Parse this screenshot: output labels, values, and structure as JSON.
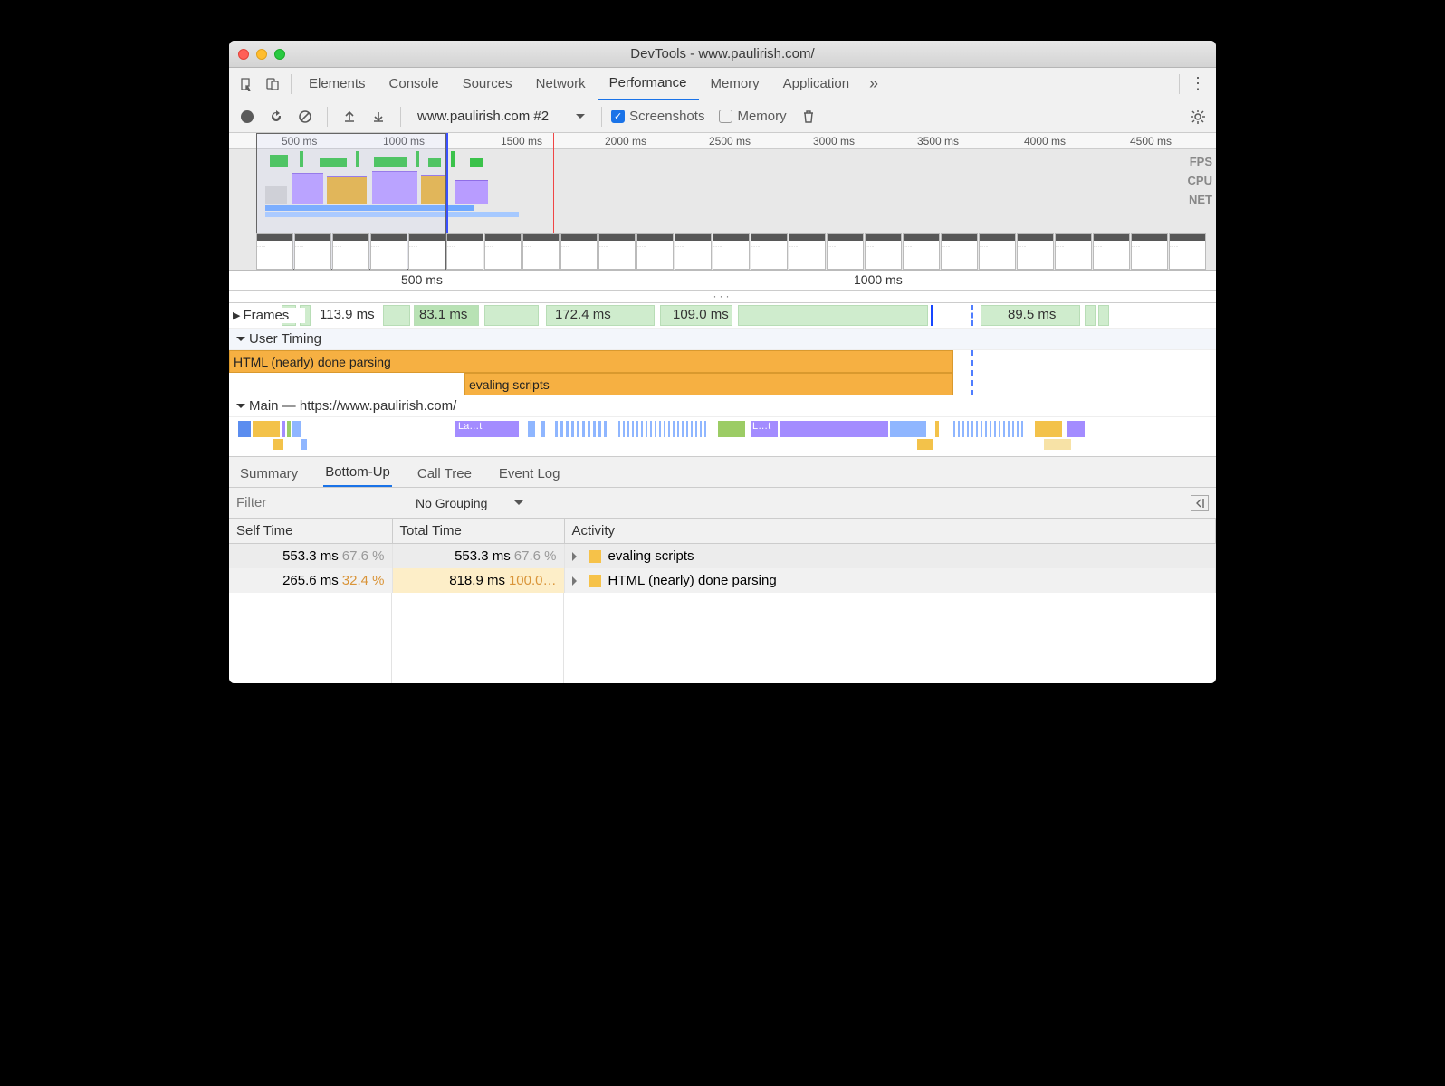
{
  "window": {
    "title": "DevTools - www.paulirish.com/"
  },
  "main_tabs": {
    "elements": "Elements",
    "console": "Console",
    "sources": "Sources",
    "network": "Network",
    "performance": "Performance",
    "memory": "Memory",
    "application": "Application"
  },
  "toolbar": {
    "record_select": "www.paulirish.com #2",
    "screenshots": "Screenshots",
    "memory": "Memory"
  },
  "overview": {
    "ticks": [
      "500 ms",
      "1000 ms",
      "1500 ms",
      "2000 ms",
      "2500 ms",
      "3000 ms",
      "3500 ms",
      "4000 ms",
      "4500 ms"
    ],
    "labels": {
      "fps": "FPS",
      "cpu": "CPU",
      "net": "NET"
    }
  },
  "detail_ruler": {
    "t500": "500 ms",
    "t1000": "1000 ms"
  },
  "frames": {
    "label": "Frames",
    "values": [
      "113.9 ms",
      "83.1 ms",
      "172.4 ms",
      "109.0 ms",
      "89.5 ms"
    ]
  },
  "user_timing": {
    "label": "User Timing",
    "bar1": "HTML (nearly) done parsing",
    "bar2": "evaling scripts"
  },
  "main_thread": {
    "label": "Main — https://www.paulirish.com/",
    "seg1": "La…t",
    "seg2": "L…t"
  },
  "sub_tabs": {
    "summary": "Summary",
    "bottom_up": "Bottom-Up",
    "call_tree": "Call Tree",
    "event_log": "Event Log"
  },
  "filter": {
    "placeholder": "Filter",
    "grouping": "No Grouping"
  },
  "table": {
    "headers": {
      "self": "Self Time",
      "total": "Total Time",
      "activity": "Activity"
    },
    "rows": [
      {
        "self": "553.3 ms",
        "self_pct": "67.6 %",
        "total": "553.3 ms",
        "total_pct": "67.6 %",
        "activity": "evaling scripts"
      },
      {
        "self": "265.6 ms",
        "self_pct": "32.4 %",
        "total": "818.9 ms",
        "total_pct": "100.0…",
        "activity": "HTML (nearly) done parsing"
      }
    ]
  }
}
